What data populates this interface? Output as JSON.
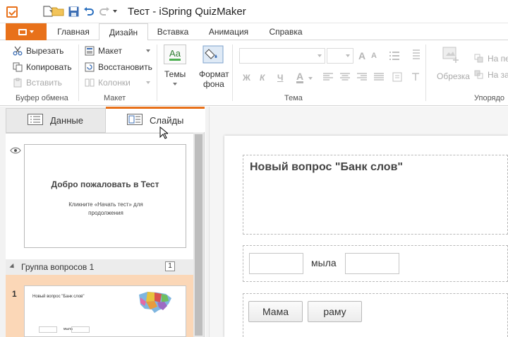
{
  "window": {
    "title": "Тест - iSpring QuizMaker"
  },
  "colors": {
    "accent": "#e8711a",
    "selected_row": "#fbd7b7"
  },
  "ribbon_tabs": [
    {
      "label": "Главная"
    },
    {
      "label": "Дизайн"
    },
    {
      "label": "Вставка"
    },
    {
      "label": "Анимация"
    },
    {
      "label": "Справка"
    }
  ],
  "active_tab": "Дизайн",
  "ribbon": {
    "clipboard": {
      "cut": "Вырезать",
      "copy": "Копировать",
      "paste": "Вставить",
      "label": "Буфер обмена"
    },
    "layout": {
      "layout": "Макет",
      "restore": "Восстановить",
      "columns": "Колонки",
      "label": "Макет"
    },
    "theme": {
      "themes": "Темы",
      "bg_line1": "Формат",
      "bg_line2": "фона",
      "label": "Тема",
      "style_sample": "Aa"
    },
    "format": {
      "bold": "Ж",
      "italic": "К",
      "underline": "Ч",
      "font_color": "A"
    },
    "image": {
      "crop": "Обрезка",
      "front": "На пе",
      "back": "На за",
      "label": "Упорядо"
    }
  },
  "left_panel": {
    "tab_data": "Данные",
    "tab_slides": "Слайды",
    "slide1": {
      "title": "Добро пожаловать в Тест",
      "subtitle": "Кликните «Начать тест» для продолжения"
    },
    "group": {
      "label": "Группа вопросов 1",
      "count": "1"
    },
    "slide2": {
      "number": "1",
      "question": "Новый вопрос \"Банк слов\"",
      "word": "мыла"
    }
  },
  "slide": {
    "question_title": "Новый вопрос \"Банк слов\"",
    "between_word": "мыла",
    "word_bank": [
      "Мама",
      "раму"
    ]
  }
}
